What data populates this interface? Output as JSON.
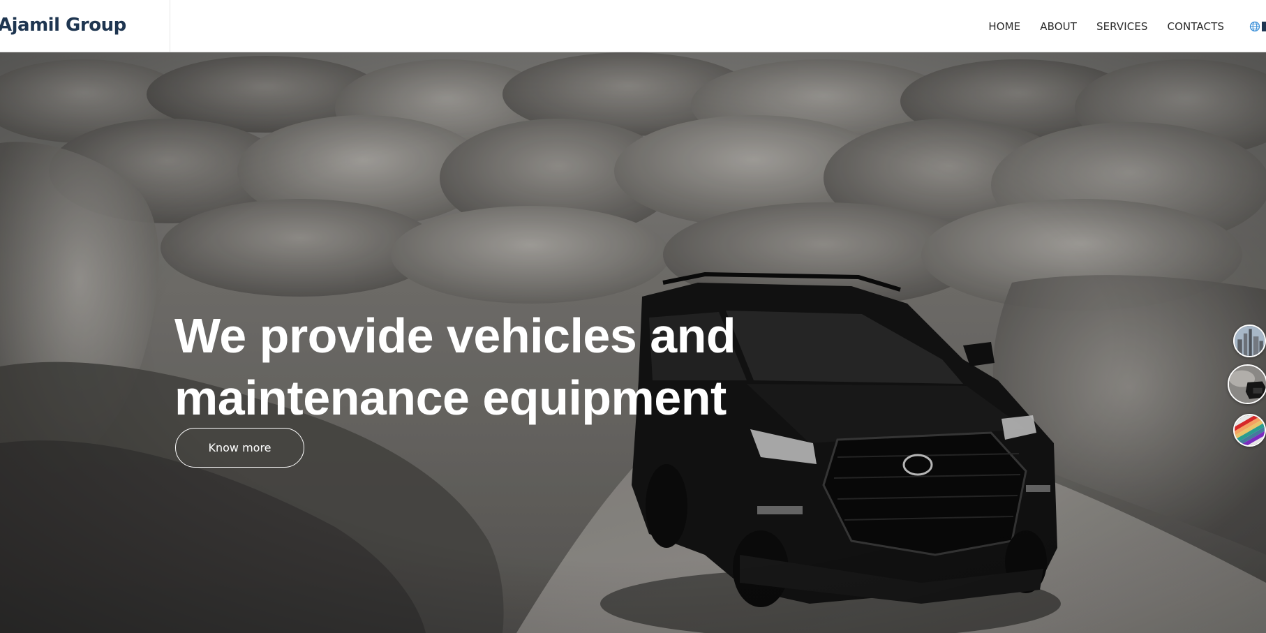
{
  "header": {
    "logo_text": "Ajamil Group",
    "nav": {
      "home": "HOME",
      "about": "ABOUT",
      "services": "SERVICES",
      "contacts": "CONTACTS"
    },
    "language_icon": "globe-icon"
  },
  "hero": {
    "title_line1": "We provide vehicles and",
    "title_line2": "maintenance equipment",
    "button_label": "Know more",
    "background_image": "black SUV driving on desert road among rocks"
  },
  "side_thumbnails": [
    {
      "name": "city-skyline-thumbnail"
    },
    {
      "name": "suv-thumbnail"
    },
    {
      "name": "color-swatches-thumbnail"
    }
  ],
  "colors": {
    "brand": "#1e3550",
    "accent_globe": "#3a8fd8",
    "text_white": "#ffffff"
  }
}
